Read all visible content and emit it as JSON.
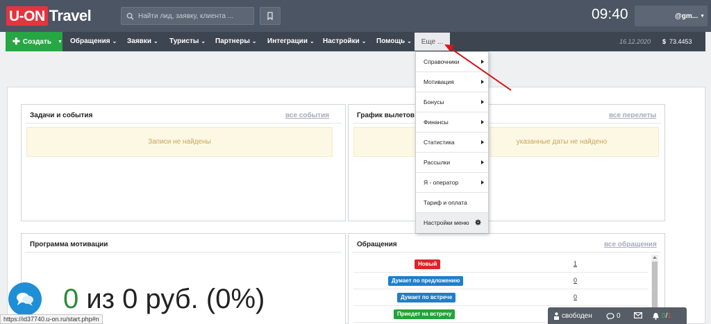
{
  "app": {
    "logo_box": "U-ON",
    "logo_text": "Travel",
    "search_placeholder": "Найти лид, заявку, клиента ...",
    "clock": "09:40",
    "user_email": "@gm..."
  },
  "nav": {
    "create_label": "Создать",
    "items": [
      "Обращения",
      "Заявки",
      "Туристы",
      "Партнеры",
      "Интеграции",
      "Настройки",
      "Помощь"
    ],
    "more_label": "Еще ...",
    "date": "16.12.2020",
    "currency_symbol": "$",
    "rate": "73.4453"
  },
  "dropdown": {
    "items": [
      "Справочники",
      "Мотивация",
      "Бонусы",
      "Финансы",
      "Статистика",
      "Рассылки",
      "Я - оператор",
      "Тариф и оплата"
    ],
    "settings_label": "Настройки меню"
  },
  "tasks": {
    "title": "Задачи и события",
    "link": "все события",
    "empty": "Записи не найдены"
  },
  "flights": {
    "title": "График вылетов",
    "link": "все перелеты",
    "empty": "указанные даты не найдено"
  },
  "motivation": {
    "title": "Программа мотивации",
    "big_zero": "0",
    "big_rest": " из 0 руб. (0%)"
  },
  "requests": {
    "title": "Обращения",
    "link": "все обращения",
    "rows": [
      {
        "label": "Новый",
        "count": "1",
        "color": "#d9252c"
      },
      {
        "label": "Думает по предложению",
        "count": "0",
        "color": "#1f7fc8"
      },
      {
        "label": "Думает по встрече",
        "count": "0",
        "color": "#1f7fc8"
      },
      {
        "label": "Приедет на встречу",
        "count": "0",
        "color": "#23a33a"
      }
    ]
  },
  "status_url": "https://id37740.u-on.ru/start.php#n",
  "widget": {
    "status": "свободен",
    "messages": "0",
    "notify_green": "0",
    "notify_sep": "/",
    "notify_red": "1"
  }
}
